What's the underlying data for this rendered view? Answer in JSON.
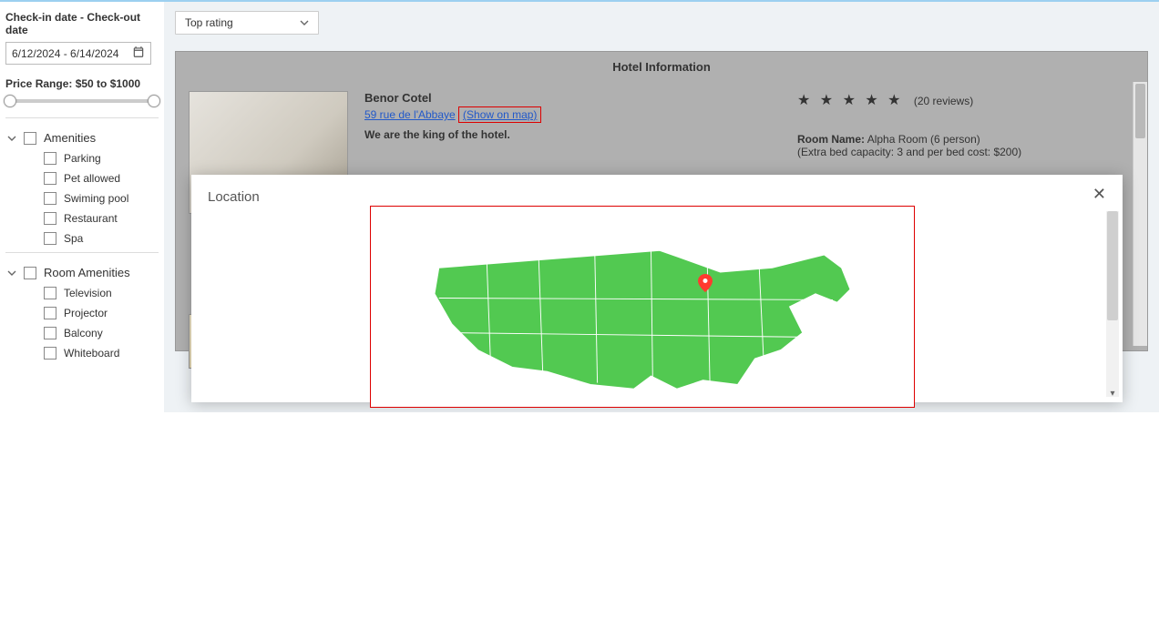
{
  "sidebar": {
    "date_heading": "Check-in date - Check-out date",
    "date_value": "6/12/2024 - 6/14/2024",
    "price_heading": "Price Range: $50 to $1000",
    "amenities": {
      "label": "Amenities",
      "items": [
        "Parking",
        "Pet allowed",
        "Swiming pool",
        "Restaurant",
        "Spa"
      ]
    },
    "room_amenities": {
      "label": "Room Amenities",
      "items": [
        "Television",
        "Projector",
        "Balcony",
        "Whiteboard"
      ]
    }
  },
  "main": {
    "sort_label": "Top rating",
    "panel_title": "Hotel Information",
    "hotel": {
      "name": "Benor Cotel",
      "address": "59 rue de l'Abbaye",
      "show_on_map": "(Show on map)",
      "tagline": "We are the king of the hotel.",
      "reviews_count": "(20 reviews)",
      "room_name_label": "Room Name:",
      "room_name_value": "Alpha Room (6 person)",
      "extra_bed": "(Extra bed capacity: 3 and per bed cost: $200)"
    }
  },
  "modal": {
    "title": "Location"
  }
}
